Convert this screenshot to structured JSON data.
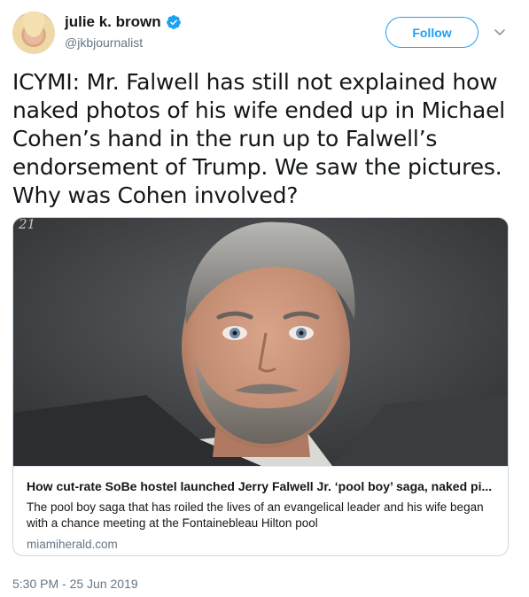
{
  "author": {
    "display_name": "julie k. brown",
    "handle": "@jkbjournalist",
    "verified": true
  },
  "actions": {
    "follow_label": "Follow"
  },
  "tweet": {
    "text": "ICYMI: Mr. Falwell has still not explained how naked photos of his wife ended up in Michael Cohen’s hand in the run up to Falwell’s endorsement of Trump. We saw the pictures. Why was Cohen involved?",
    "timestamp": "5:30 PM - 25 Jun 2019"
  },
  "card": {
    "image_overlay_text": "21",
    "title": "How cut-rate SoBe hostel launched Jerry Falwell Jr. ‘pool boy’ saga, naked pi...",
    "description": "The pool boy saga that has roiled the lives of an evangelical leader and his wife began with a chance meeting at the Fontainebleau Hilton pool",
    "domain": "miamiherald.com"
  },
  "colors": {
    "accent": "#1da1f2",
    "secondary_text": "#657786",
    "border": "#ccd6dd"
  },
  "icons": {
    "verified": "verified-badge-icon",
    "more": "chevron-down-icon"
  }
}
